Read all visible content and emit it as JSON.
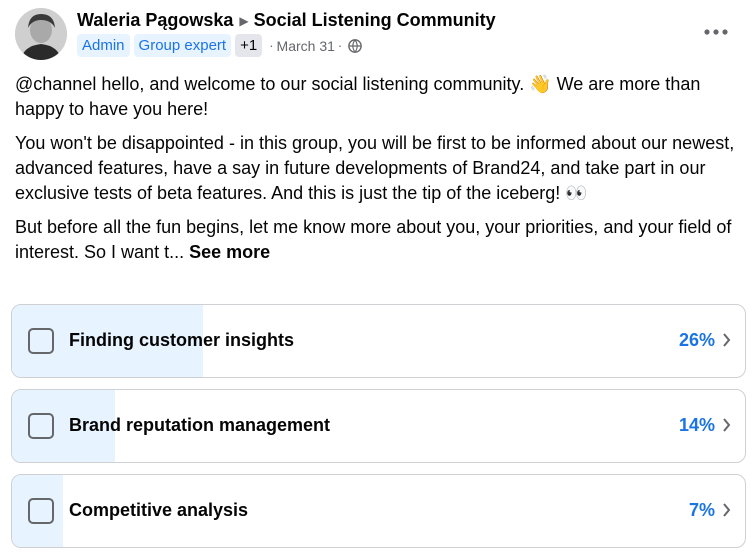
{
  "post": {
    "author": "Waleria Pągowska",
    "group": "Social Listening Community",
    "badges": [
      "Admin",
      "Group expert"
    ],
    "extra_badges": "+1",
    "date": "March 31",
    "paragraphs": [
      "@channel hello, and welcome to our social listening community. 👋 We are more than happy to have you here!",
      "You won't be disappointed - in this group, you will be first to be informed about our newest, advanced features, have a say in future developments of Brand24, and take part in our exclusive tests of beta features. And this is just the tip of the iceberg! 👀",
      "But before all the fun begins, let me know more about you, your priorities, and your field of interest. So I want t..."
    ],
    "see_more": "See more"
  },
  "poll": {
    "options": [
      {
        "label": "Finding customer insights",
        "percent": "26%",
        "fill": 0.26
      },
      {
        "label": "Brand reputation management",
        "percent": "14%",
        "fill": 0.14
      },
      {
        "label": "Competitive analysis",
        "percent": "7%",
        "fill": 0.07
      }
    ]
  },
  "icons": {
    "separator": "caret-right-icon",
    "privacy": "globe-icon",
    "menu": "more-options-icon",
    "option_arrow": "chevron-right-icon"
  },
  "colors": {
    "accent": "#1b74e4",
    "fill": "#e7f3ff",
    "badge_bg": "#e7f3ff"
  }
}
